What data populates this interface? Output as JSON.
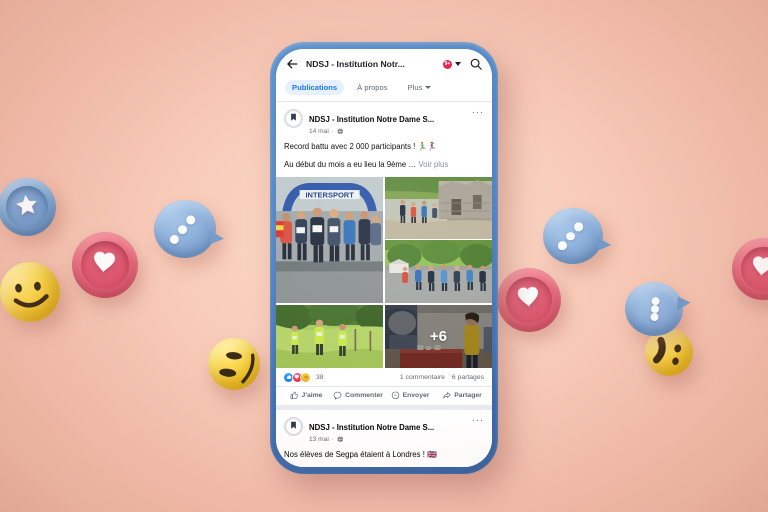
{
  "scene": {
    "background_color": "#F8CCB9",
    "phone_frame_color": "#4A7FC1",
    "device": "smartphone-mockup"
  },
  "app_bar": {
    "back_icon": "back-arrow-icon",
    "title": "NDSJ - Institution Notr...",
    "notification_badge": "9+",
    "dropdown_icon": "chevron-down-icon",
    "search_icon": "search-icon"
  },
  "tabs": [
    {
      "label": "Publications",
      "active": true
    },
    {
      "label": "À propos",
      "active": false
    },
    {
      "label": "Plus",
      "active": false,
      "has_chevron": true
    }
  ],
  "posts": [
    {
      "author": "NDSJ - Institution Notre Dame S...",
      "time": "14 mai",
      "privacy_icon": "globe-icon",
      "menu_icon": "ellipsis-icon",
      "text_line_1": "Record battu avec 2 000 participants ! 🏃‍♂️🏃‍♀️",
      "text_line_2": "Au début du mois a eu lieu la 9ème …",
      "see_more": "Voir plus",
      "photos": [
        {
          "name": "runners-start-line-intersport-arch"
        },
        {
          "name": "runners-stone-ruins-path"
        },
        {
          "name": "crowd-race-tree-lined-street"
        },
        {
          "name": "trail-runners-green-field"
        },
        {
          "name": "volunteer-refreshment-stand",
          "overlay": "+6"
        }
      ],
      "reactions": {
        "icons": [
          "like-reaction",
          "love-reaction",
          "care-reaction"
        ],
        "count": "38"
      },
      "comments": "1 commentaire",
      "shares": "6 partages",
      "actions": [
        {
          "label": "J'aime",
          "icon": "thumbs-up-icon"
        },
        {
          "label": "Commenter",
          "icon": "comment-bubble-icon"
        },
        {
          "label": "Envoyer",
          "icon": "messenger-icon"
        },
        {
          "label": "Partager",
          "icon": "share-arrow-icon"
        }
      ]
    },
    {
      "author": "NDSJ - Institution Notre Dame S...",
      "time": "13 mai",
      "privacy_icon": "globe-icon",
      "menu_icon": "ellipsis-icon",
      "text_line_1": "Nos élèves de Segpa étaient à Londres ! 🇬🇧"
    }
  ],
  "props": [
    {
      "name": "star-badge-blue",
      "glyph": "star"
    },
    {
      "name": "heart-badge-pink",
      "glyph": "heart"
    },
    {
      "name": "smiley-emoji-yellow",
      "glyph": "smile"
    },
    {
      "name": "speech-bubble-blue",
      "glyph": "dots"
    },
    {
      "name": "laughing-emoji-yellow",
      "glyph": "laugh"
    },
    {
      "name": "heart-badge-pink-right",
      "glyph": "heart"
    },
    {
      "name": "speech-bubble-blue-right",
      "glyph": "dots"
    },
    {
      "name": "wink-emoji-yellow",
      "glyph": "wink"
    },
    {
      "name": "heart-badge-pink-edge",
      "glyph": "heart"
    },
    {
      "name": "speech-bubble-blue-upper",
      "glyph": "dots"
    }
  ]
}
